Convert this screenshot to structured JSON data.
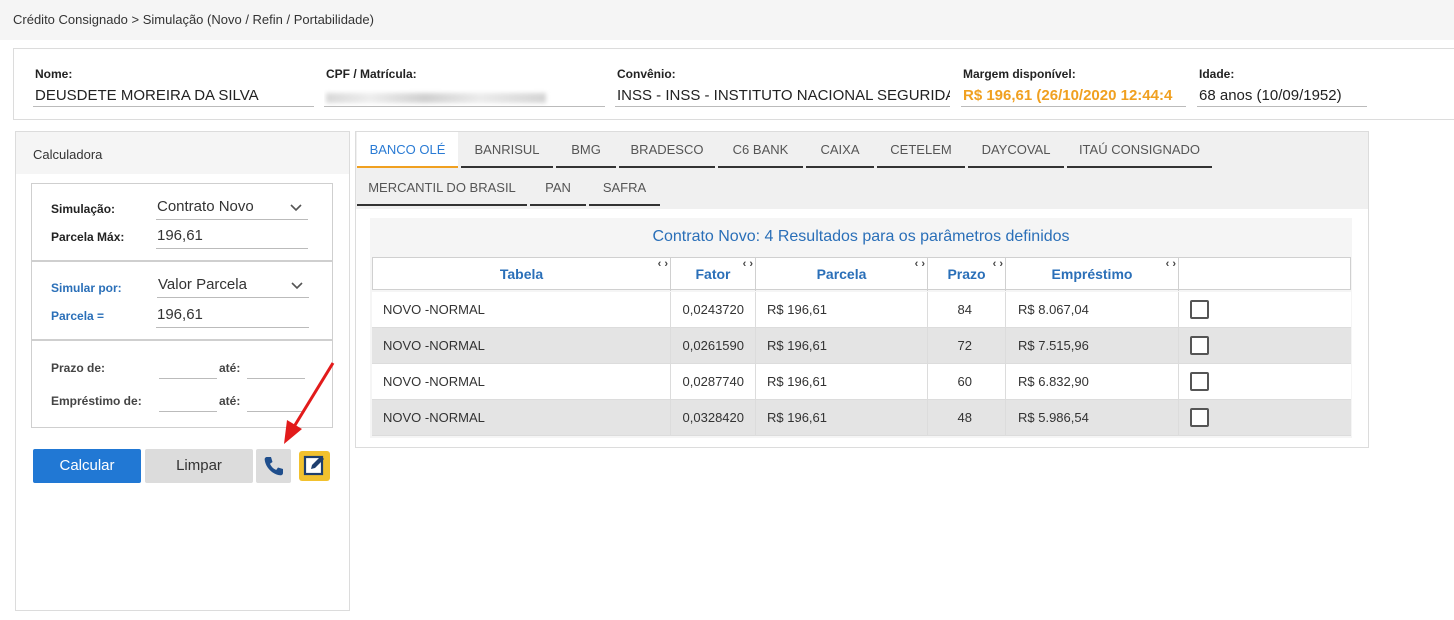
{
  "breadcrumb": "Crédito Consignado > Simulação (Novo / Refin / Portabilidade)",
  "header": {
    "nome_label": "Nome:",
    "nome_value": "DEUSDETE MOREIRA DA SILVA",
    "cpf_label": "CPF / Matrícula:",
    "convenio_label": "Convênio:",
    "convenio_value": "INSS - INSS - INSTITUTO NACIONAL SEGURIDADE",
    "margem_label": "Margem disponível:",
    "margem_value": "R$ 196,61 (26/10/2020 12:44:4",
    "idade_label": "Idade:",
    "idade_value": "68 anos (10/09/1952)"
  },
  "calculator": {
    "title": "Calculadora",
    "simulacao_label": "Simulação:",
    "simulacao_value": "Contrato Novo",
    "parcela_max_label": "Parcela Máx:",
    "parcela_max_value": "196,61",
    "simular_por_label": "Simular por:",
    "simular_por_value": "Valor Parcela",
    "parcela_label": "Parcela =",
    "parcela_value": "196,61",
    "prazo_de_label": "Prazo de:",
    "ate_label": "até:",
    "emprestimo_de_label": "Empréstimo de:",
    "calcular_label": "Calcular",
    "limpar_label": "Limpar"
  },
  "tabs": [
    "BANCO OLÉ",
    "BANRISUL",
    "BMG",
    "BRADESCO",
    "C6 BANK",
    "CAIXA",
    "CETELEM",
    "DAYCOVAL",
    "ITAÚ CONSIGNADO",
    "MERCANTIL DO BRASIL",
    "PAN",
    "SAFRA"
  ],
  "results": {
    "title": "Contrato Novo: 4 Resultados para os parâmetros definidos",
    "columns": [
      "Tabela",
      "Fator",
      "Parcela",
      "Prazo",
      "Empréstimo"
    ],
    "sort_glyph": "‹ ›",
    "rows": [
      {
        "tabela": "NOVO -NORMAL",
        "fator": "0,0243720",
        "parcela": "R$ 196,61",
        "prazo": "84",
        "emprestimo": "R$ 8.067,04"
      },
      {
        "tabela": "NOVO -NORMAL",
        "fator": "0,0261590",
        "parcela": "R$ 196,61",
        "prazo": "72",
        "emprestimo": "R$ 7.515,96"
      },
      {
        "tabela": "NOVO -NORMAL",
        "fator": "0,0287740",
        "parcela": "R$ 196,61",
        "prazo": "60",
        "emprestimo": "R$ 6.832,90"
      },
      {
        "tabela": "NOVO -NORMAL",
        "fator": "0,0328420",
        "parcela": "R$ 196,61",
        "prazo": "48",
        "emprestimo": "R$ 5.986,54"
      }
    ]
  },
  "colors": {
    "accent_blue": "#2a6fb8",
    "button_blue": "#2178d4",
    "margin_orange": "#f0a020",
    "annotation_red": "#e21b1b"
  },
  "icons": {
    "phone": "phone-icon",
    "edit": "edit-icon",
    "chevron": "chevron-down-icon",
    "arrow": "red-arrow-annotation"
  }
}
